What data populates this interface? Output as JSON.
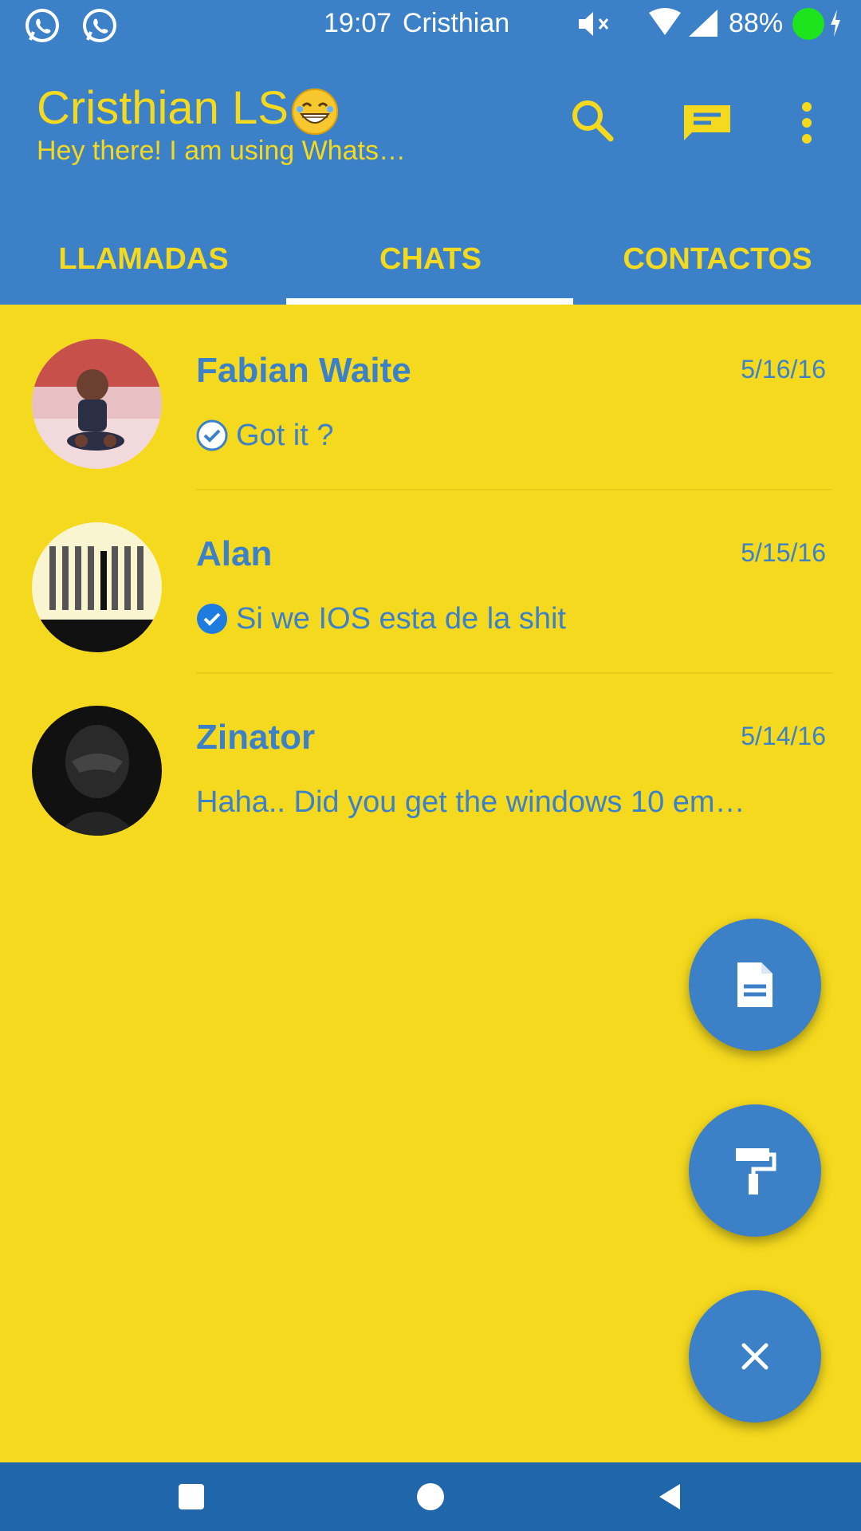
{
  "colors": {
    "primary": "#3C81C8",
    "accent": "#F5D91E",
    "background": "#F5D91E",
    "navbar": "#1F66AA",
    "battery_dot": "#1EE41E"
  },
  "status_bar": {
    "time": "19:07",
    "carrier": "Cristhian",
    "battery": "88%",
    "icons": [
      "whatsapp-icon",
      "whatsapp-icon",
      "mute-icon",
      "wifi-icon",
      "signal-icon",
      "battery-icon",
      "bolt-icon"
    ]
  },
  "app_bar": {
    "title": "Cristhian LS",
    "subtitle": "Hey there! I am using Whats…",
    "actions": [
      "search-icon",
      "new-chat-icon",
      "more-vert-icon"
    ]
  },
  "tabs": [
    {
      "label": "LLAMADAS",
      "selected": false
    },
    {
      "label": "CHATS",
      "selected": true
    },
    {
      "label": "CONTACTOS",
      "selected": false
    }
  ],
  "chats": [
    {
      "name": "Fabian Waite",
      "date": "5/16/16",
      "preview": "Got it ?",
      "status": "delivered"
    },
    {
      "name": "Alan",
      "date": "5/15/16",
      "preview": "Si we IOS esta de la shit",
      "status": "read"
    },
    {
      "name": "Zinator",
      "date": "5/14/16",
      "preview": "Haha.. Did you get the windows 10 em…",
      "status": "none"
    }
  ],
  "fabs": [
    "document-icon",
    "paint-roller-icon",
    "close-icon"
  ],
  "nav": [
    "recents-square-icon",
    "home-circle-icon",
    "back-triangle-icon"
  ]
}
